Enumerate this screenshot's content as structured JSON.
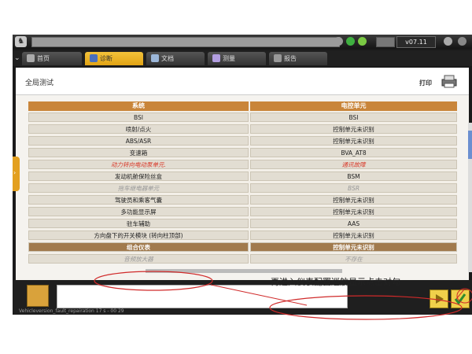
{
  "app": {
    "version": "v07.11",
    "logo_glyph": "♞",
    "status_line": "Vehicleversion_fault_repairation 17 s - 00 29"
  },
  "tabs": [
    {
      "label": "首页",
      "icon": "home-icon",
      "active": false
    },
    {
      "label": "诊断",
      "icon": "diagnosis-icon",
      "active": true
    },
    {
      "label": "文档",
      "icon": "document-icon",
      "active": false
    },
    {
      "label": "测量",
      "icon": "measure-icon",
      "active": false
    },
    {
      "label": "报告",
      "icon": "report-icon",
      "active": false
    }
  ],
  "page": {
    "title": "全局测试",
    "print_label": "打印"
  },
  "table": {
    "headers": [
      "系统",
      "电控单元"
    ],
    "rows": [
      {
        "system": "BSI",
        "ecu": "BSI",
        "state": "normal"
      },
      {
        "system": "喷射/点火",
        "ecu": "控制单元未识别",
        "state": "normal"
      },
      {
        "system": "ABS/ASR",
        "ecu": "控制单元未识别",
        "state": "normal"
      },
      {
        "system": "变速箱",
        "ecu": "BVA_AT8",
        "state": "normal"
      },
      {
        "system": "动力转向电动泵单元.",
        "ecu": "通讯故障",
        "state": "error"
      },
      {
        "system": "发动机舱保险丝盒",
        "ecu": "BSM",
        "state": "normal"
      },
      {
        "system": "拖车继电器单元",
        "ecu": "BSR",
        "state": "absent"
      },
      {
        "system": "驾驶员和乘客气囊",
        "ecu": "控制单元未识别",
        "state": "normal"
      },
      {
        "system": "多功能显示屏",
        "ecu": "控制单元未识别",
        "state": "normal"
      },
      {
        "system": "驻车辅助",
        "ecu": "AAS",
        "state": "normal"
      },
      {
        "system": "方向盘下的开关模块 (转向柱顶部)",
        "ecu": "控制单元未识别",
        "state": "normal"
      },
      {
        "system": "组合仪表",
        "ecu": "控制单元未识别",
        "state": "selected"
      },
      {
        "system": "音频放大器",
        "ecu": "不存在",
        "state": "absent"
      }
    ]
  },
  "annotation": {
    "text": "再进入仪表配置巡航显示点击对勾",
    "color": "#d02a2a"
  },
  "colors": {
    "accent": "#e2a415",
    "header": "#c9853a",
    "selected_row": "#a17a4d",
    "error_text": "#d83a2a"
  }
}
